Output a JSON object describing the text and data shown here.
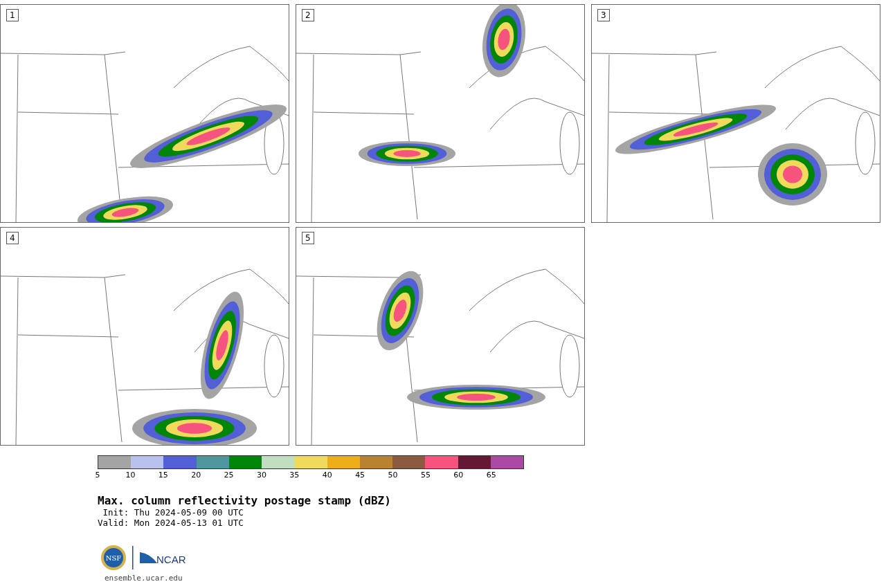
{
  "panels": [
    {
      "label": "1",
      "kind": "picture"
    },
    {
      "label": "2",
      "kind": "picture"
    },
    {
      "label": "3",
      "kind": "picture"
    },
    {
      "label": "4",
      "kind": "picture"
    },
    {
      "label": "5",
      "kind": "picture"
    }
  ],
  "colorbar": {
    "segments": [
      {
        "color": "#a4a4a4"
      },
      {
        "color": "#b8c2ec"
      },
      {
        "color": "#525fd6"
      },
      {
        "color": "#4f979e"
      },
      {
        "color": "#01860a"
      },
      {
        "color": "#c0dfc0"
      },
      {
        "color": "#f0da5c"
      },
      {
        "color": "#eeae17"
      },
      {
        "color": "#b98231"
      },
      {
        "color": "#8b5a3f"
      },
      {
        "color": "#f6537e"
      },
      {
        "color": "#661736"
      },
      {
        "color": "#ab4aa4"
      }
    ],
    "ticks": [
      "5",
      "10",
      "15",
      "20",
      "25",
      "30",
      "35",
      "40",
      "45",
      "50",
      "55",
      "60",
      "65"
    ]
  },
  "title": "Max. column reflectivity postage stamp (dBZ)",
  "init": " Init: Thu 2024-05-09 00 UTC",
  "valid": "Valid: Mon 2024-05-13 01 UTC",
  "logos": {
    "nsf": "NSF",
    "ncar": "NCAR"
  },
  "url": "ensemble.ucar.edu"
}
